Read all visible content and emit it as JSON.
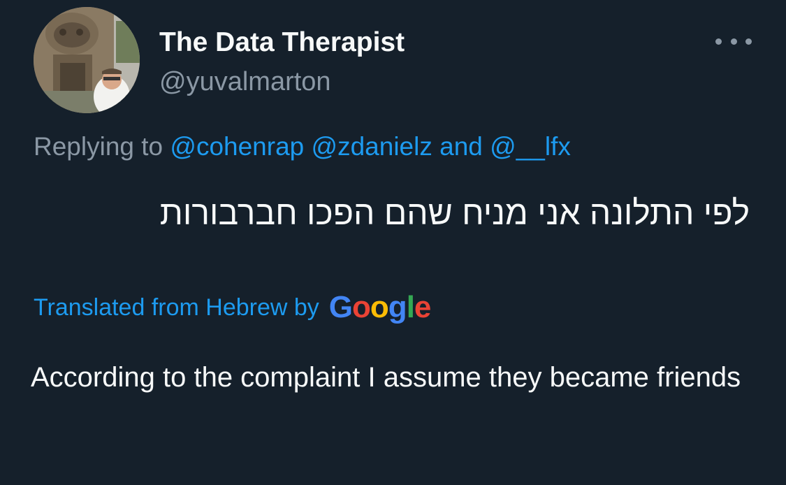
{
  "tweet": {
    "author": {
      "display_name": "The Data Therapist",
      "handle": "@yuvalmarton",
      "avatar_icon": "profile-photo"
    },
    "more_icon": "more-horizontal-icon",
    "replying": {
      "prefix": "Replying to ",
      "mention_1": "@cohenrap",
      "mention_2": "@zdanielz",
      "connector": " and ",
      "mention_3": "@__lfx"
    },
    "original_text": "לפי התלונה אני מניח שהם הפכו חברבורות",
    "translation_label": "Translated from Hebrew by",
    "google_logo": {
      "letters": [
        "G",
        "o",
        "o",
        "g",
        "l",
        "e"
      ],
      "colors": [
        "#4285f4",
        "#ea4335",
        "#fbbc05",
        "#4285f4",
        "#34a853",
        "#ea4335"
      ]
    },
    "translated_text": "According to the complaint I assume they became friends"
  },
  "colors": {
    "background": "#15202b",
    "primary_text": "#f7f9f9",
    "secondary_text": "#8b98a5",
    "accent": "#1d9bf0"
  }
}
